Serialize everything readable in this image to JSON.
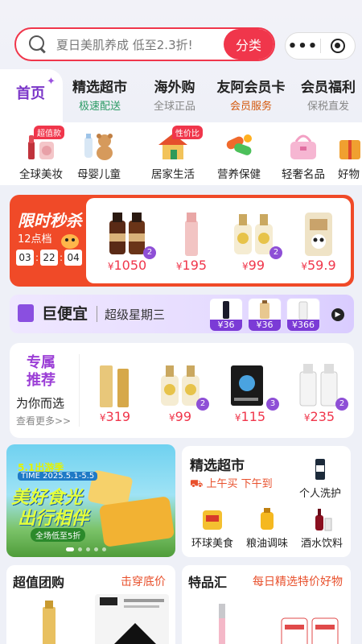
{
  "search": {
    "placeholder": "夏日美肌养成 低至2.3折!",
    "button": "分类"
  },
  "capsule": {
    "more": "•••"
  },
  "tabs": [
    {
      "title": "首页",
      "sub": ""
    },
    {
      "title": "精选超市",
      "sub": "极速配送"
    },
    {
      "title": "海外购",
      "sub": "全球正品"
    },
    {
      "title": "友阿会员卡",
      "sub": "会员服务"
    },
    {
      "title": "会员福利",
      "sub": "保税直发"
    }
  ],
  "categories": [
    {
      "label": "全球美妆",
      "tag": "超值款"
    },
    {
      "label": "母婴儿童",
      "tag": ""
    },
    {
      "label": "居家生活",
      "tag": "性价比"
    },
    {
      "label": "营养保健",
      "tag": ""
    },
    {
      "label": "轻奢名品",
      "tag": ""
    },
    {
      "label": "好物",
      "tag": ""
    }
  ],
  "flash_sale": {
    "title": "限时秒杀",
    "session": "12点档",
    "countdown": [
      "03",
      "22",
      "04"
    ],
    "items": [
      {
        "price": "1050",
        "badge": "2"
      },
      {
        "price": "195",
        "badge": ""
      },
      {
        "price": "99",
        "badge": "2"
      },
      {
        "price": "59.9",
        "badge": ""
      }
    ]
  },
  "jubianyi": {
    "title": "巨便宜",
    "subtitle": "超级星期三",
    "items": [
      {
        "price": "¥36"
      },
      {
        "price": "¥36"
      },
      {
        "price": "¥366"
      }
    ],
    "arrow": "▶"
  },
  "exclusive": {
    "title_line1": "专属",
    "title_line2": "推荐",
    "subtitle": "为你而选",
    "more": "查看更多>>",
    "items": [
      {
        "price": "319",
        "badge": ""
      },
      {
        "price": "99",
        "badge": "2"
      },
      {
        "price": "115",
        "badge": "3"
      },
      {
        "price": "235",
        "badge": "2"
      }
    ]
  },
  "banner": {
    "line1": "5.1出游季",
    "line2": "TIME 2025.5.1-5.5",
    "line3": "美好食光",
    "line4": "出行相伴",
    "line5": "全场低至5折"
  },
  "supermarket": {
    "title": "精选超市",
    "slogan": "上午买 下午到",
    "items": [
      {
        "label": "个人洗护"
      },
      {
        "label": "环球美食"
      },
      {
        "label": "粮油调味"
      },
      {
        "label": "酒水饮料"
      }
    ]
  },
  "group_buy": {
    "title": "超值团购",
    "link": "击穿底价"
  },
  "special": {
    "title": "特品汇",
    "link": "每日精选特价好物"
  },
  "colors": {
    "accent": "#f0364b",
    "purple": "#7a35c8",
    "orange": "#f04a28"
  }
}
